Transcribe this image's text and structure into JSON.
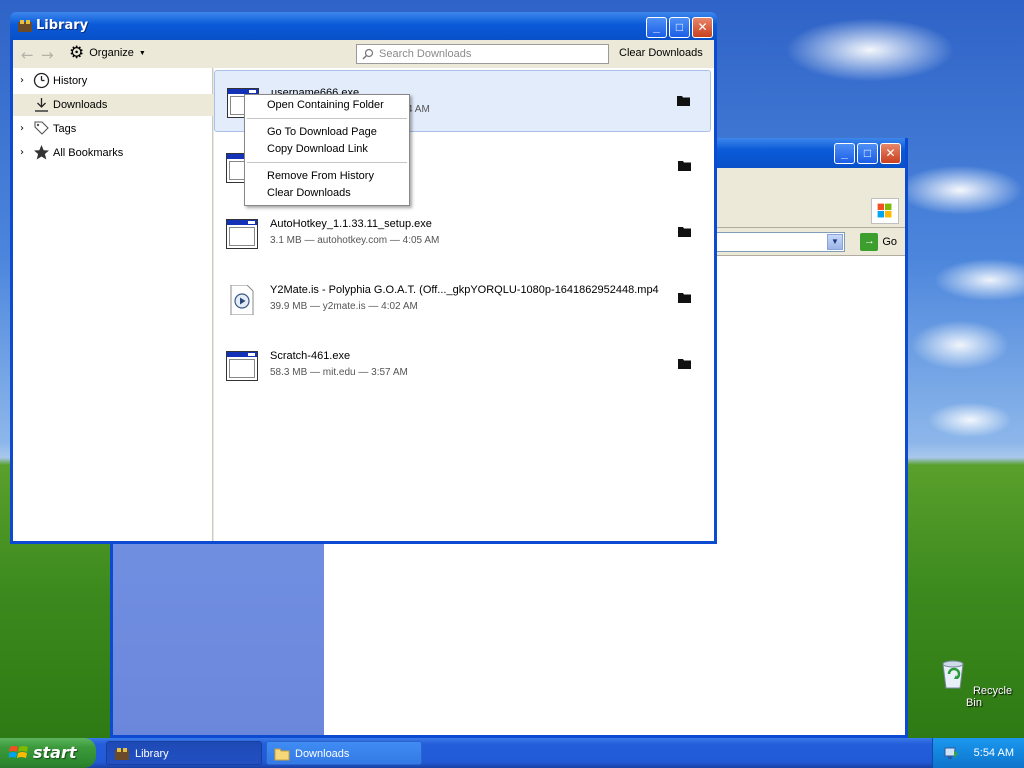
{
  "desktop": {
    "recycle_bin_label": "Recycle Bin"
  },
  "library": {
    "title": "Library",
    "toolbar": {
      "organize_label": "Organize",
      "search_placeholder": "Search Downloads",
      "clear_downloads_label": "Clear Downloads"
    },
    "sidebar": {
      "items": [
        {
          "label": "History",
          "icon": "clock-icon",
          "expandable": true
        },
        {
          "label": "Downloads",
          "icon": "download-arrow-icon",
          "expandable": false,
          "selected": true
        },
        {
          "label": "Tags",
          "icon": "tag-icon",
          "expandable": true
        },
        {
          "label": "All Bookmarks",
          "icon": "star-icon",
          "expandable": true
        }
      ]
    },
    "downloads": [
      {
        "name": "username666.exe",
        "meta": "4 AM",
        "type": "exe",
        "selected": true
      },
      {
        "name": "",
        "meta": "",
        "type": "exe"
      },
      {
        "name": "AutoHotkey_1.1.33.11_setup.exe",
        "meta": "3.1 MB — autohotkey.com — 4:05 AM",
        "type": "exe"
      },
      {
        "name": "Y2Mate.is - Polyphia  G.O.A.T. (Off..._gkpYORQLU-1080p-1641862952448.mp4",
        "meta": "39.9 MB — y2mate.is — 4:02 AM",
        "type": "media"
      },
      {
        "name": "Scratch-461.exe",
        "meta": "58.3 MB — mit.edu — 3:57 AM",
        "type": "exe"
      }
    ],
    "context_menu": {
      "items": [
        "Open Containing Folder",
        "Go To Download Page",
        "Copy Download Link",
        "Remove From History",
        "Clear Downloads"
      ]
    }
  },
  "background_window": {
    "go_label": "Go"
  },
  "taskbar": {
    "start_label": "start",
    "tasks": [
      {
        "label": "Library",
        "active": true
      },
      {
        "label": "Downloads",
        "active": false
      }
    ],
    "clock": "5:54 AM"
  }
}
